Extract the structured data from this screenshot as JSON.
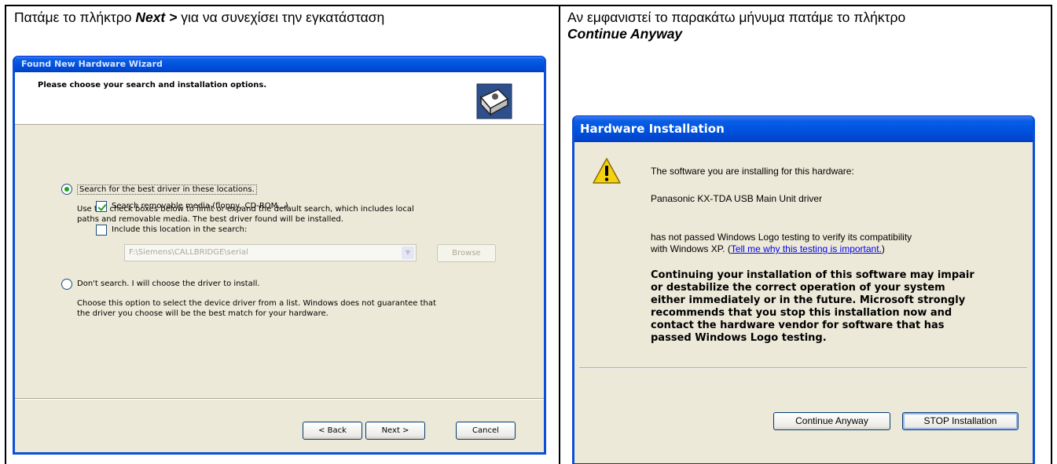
{
  "left_instruction": {
    "prefix": "Πατάμε το πλήκτρο ",
    "key": "Next >",
    "suffix": " για να συνεχίσει την εγκατάσταση"
  },
  "right_instruction": {
    "line1": "Αν εμφανιστεί το παρακάτω μήνυμα πατάμε το πλήκτρο",
    "key": "Continue Anyway"
  },
  "wizard": {
    "title": "Found New Hardware Wizard",
    "header": "Please choose your search and installation options.",
    "option_search": "Search for the best driver in these locations.",
    "search_desc_1": "Use the check boxes below to limit or expand the default search, which includes local",
    "search_desc_2": "paths and removable media. The best driver found will be installed.",
    "check_removable": "Search removable media (floppy, CD-ROM...)",
    "check_include": "Include this location in the search:",
    "location_value": "F:\\Siemens\\CALLBRIDGE\\serial",
    "browse_label": "Browse",
    "option_dont": "Don't search. I will choose the driver to install.",
    "dont_desc_1": "Choose this option to select the device driver from a list.  Windows does not guarantee that",
    "dont_desc_2": "the driver you choose will be the best match for your hardware.",
    "back_label": "< Back",
    "next_label": "Next >",
    "cancel_label": "Cancel"
  },
  "hw": {
    "title": "Hardware Installation",
    "line1": "The software you are installing for this hardware:",
    "device": "Panasonic KX-TDA USB Main Unit driver",
    "line3": "has not passed Windows Logo testing to verify its compatibility",
    "line4_prefix": "with Windows XP. (",
    "link": "Tell me why this testing is important.",
    "line4_suffix": ")",
    "bold": [
      "Continuing your installation of this software may impair",
      "or destabilize the correct operation of your system",
      "either immediately or in the future. Microsoft strongly",
      "recommends that you stop this installation now and",
      "contact the hardware vendor for software that has",
      "passed Windows Logo testing."
    ],
    "continue_label": "Continue Anyway",
    "stop_label": "STOP Installation"
  }
}
